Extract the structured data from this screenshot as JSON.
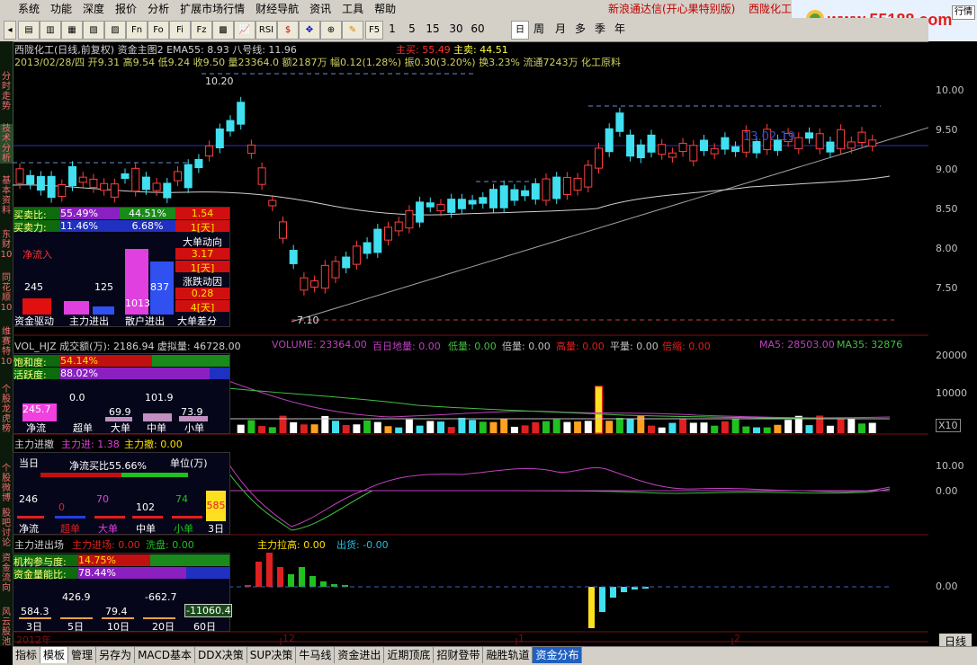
{
  "menu": [
    "系统",
    "功能",
    "深度",
    "报价",
    "分析",
    "扩展市场行情",
    "财经导航",
    "资讯",
    "工具",
    "帮助"
  ],
  "title_right": "新浪通达信(开心果特别版)",
  "stock_name": "西陇化工",
  "logo": "www.55188.com",
  "right_top_btn": "行情",
  "toolbar": {
    "buttons": [
      "F5",
      "1",
      "5",
      "15",
      "30",
      "60",
      "日",
      "周",
      "月",
      "多",
      "季",
      "年"
    ]
  },
  "left_vtabs": [
    "分时走势",
    "技术分析",
    "基本资料",
    "东财10",
    "同花顺10",
    "维赛特10",
    "个股龙虎榜",
    "个股微博",
    "股吧讨论",
    "资金流向",
    "风云股池"
  ],
  "main_info": {
    "line1": "西陇化工(日线,前复权) 资金主图2 EMA55: 8.93 八号线: 11.96",
    "line1_b": "主买: 55.49",
    "line1_c": "主卖: 44.51",
    "line2": "2013/02/28/四 开9.31 高9.54 低9.24 收9.50 量23364.0 额2187万 幅0.12(1.28%) 振0.30(3.20%) 换3.23% 流通7243万 化工原料",
    "high_mark": "10.20",
    "low_mark": "7.10",
    "date_mark": "13.02.19"
  },
  "price_axis": [
    "10.00",
    "9.50",
    "9.00",
    "8.50",
    "8.00",
    "7.50"
  ],
  "mini_panel_1": {
    "buy_ratio_label": "买卖比:",
    "buy_ratio": "55.49%",
    "sell_ratio": "44.51%",
    "ratio_days": "1.54",
    "ratio_days2": "1[天]",
    "force_label": "买卖力:",
    "force_a": "11.46%",
    "force_b": "6.68%",
    "net_in": "净流入",
    "big_label": "大单动向",
    "big_val": "3.17",
    "big_days": "1[天]",
    "rise_label": "涨跌动因",
    "rise_val": "0.28",
    "rise_days": "4[天]",
    "bars": [
      {
        "label": "资金驱动",
        "value": "245"
      },
      {
        "label": "主力进出",
        "value": "194"
      },
      {
        "label": "散户进出",
        "value": "125"
      }
    ],
    "retail": "1013",
    "big_gap_val": "837",
    "big_gap_label": "大单差分"
  },
  "volume_info": {
    "title": "VOL_HJZ 成交额(万): 2186.94 虚拟量: 46728.00",
    "volume": "VOLUME: 23364.00",
    "baidi": "百日地量: 0.00",
    "diliang": "低量: 0.00",
    "beiliang": "倍量: 0.00",
    "gaoliang": "高量: 0.00",
    "pingliang": "平量: 0.00",
    "beisuo": "倍缩: 0.00",
    "ma5": "MA5: 28503.00",
    "ma35": "MA35: 32876"
  },
  "volume_axis": [
    "20000",
    "10000"
  ],
  "volume_x10": "X10",
  "mini_panel_2": {
    "saturation_label": "饱和度:",
    "saturation": "54.14%",
    "activity_label": "活跃度:",
    "activity": "88.02%",
    "items": [
      {
        "label": "净流",
        "value": "245.7"
      },
      {
        "label": "超单",
        "value": "0.0"
      },
      {
        "label": "大单",
        "value": "69.9"
      },
      {
        "label": "中单",
        "value": "101.9"
      },
      {
        "label": "小单",
        "value": "73.9"
      }
    ]
  },
  "mainforce_info": {
    "title": "主力进撤",
    "in": "主力进: 1.38",
    "out": "主力撤: 0.00"
  },
  "mainforce_axis": [
    "10.00",
    "0.00"
  ],
  "mini_panel_3": {
    "today": "当日",
    "net_ratio": "净流买比55.66%",
    "unit": "单位(万)",
    "items": [
      {
        "label": "净流",
        "value": "246"
      },
      {
        "label": "超单",
        "value": "0"
      },
      {
        "label": "大单",
        "value": "70"
      },
      {
        "label": "中单",
        "value": "102"
      },
      {
        "label": "小单",
        "value": "74"
      }
    ],
    "three_day_val": "585",
    "three_day": "3日"
  },
  "inout_info": {
    "title": "主力进出场",
    "in": "主力进场: 0.00",
    "wash": "洗盘: 0.00",
    "raise": "主力拉高: 0.00",
    "out": "出货: -0.00"
  },
  "inout_axis": [
    "0.00"
  ],
  "mini_panel_4": {
    "inst_label": "机构参与度:",
    "inst": "14.75%",
    "energy_label": "资金量能比:",
    "energy": "78.44%",
    "periods": [
      {
        "label": "3日",
        "value": "584.3"
      },
      {
        "label": "5日",
        "value": "426.9"
      },
      {
        "label": "10日",
        "value": "79.4"
      },
      {
        "label": "20日",
        "value": "-662.7"
      },
      {
        "label": "60日",
        "value": "-11060.4"
      }
    ]
  },
  "time_axis": {
    "year": "2012年",
    "m1": "12",
    "m2": "1",
    "m3": "2"
  },
  "bottom_tabs": [
    "指标",
    "模板",
    "管理",
    "另存为",
    "MACD基本",
    "DDX决策",
    "SUP决策",
    "牛马线",
    "资金进出",
    "近期顶底",
    "招财登带",
    "融胜轨道",
    "资金分布"
  ],
  "right_bottom": "日线"
}
